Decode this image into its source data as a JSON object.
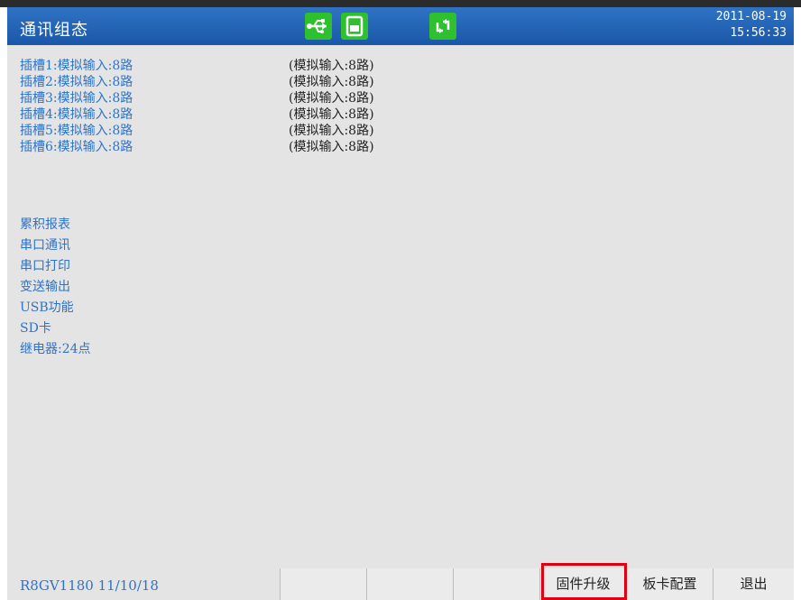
{
  "header": {
    "title": "通讯组态",
    "icons": [
      "usb-icon",
      "sd-card-icon",
      "sync-icon"
    ],
    "date": "2011-08-19",
    "time": "15:56:33",
    "colors": {
      "bar": "#1f5fb0",
      "usb": "#2ec02e",
      "sync": "#2ec02e"
    }
  },
  "slots": [
    {
      "label": "插槽1:模拟输入:8路",
      "detail": "(模拟输入:8路)"
    },
    {
      "label": "插槽2:模拟输入:8路",
      "detail": "(模拟输入:8路)"
    },
    {
      "label": "插槽3:模拟输入:8路",
      "detail": "(模拟输入:8路)"
    },
    {
      "label": "插槽4:模拟输入:8路",
      "detail": "(模拟输入:8路)"
    },
    {
      "label": "插槽5:模拟输入:8路",
      "detail": "(模拟输入:8路)"
    },
    {
      "label": "插槽6:模拟输入:8路",
      "detail": "(模拟输入:8路)"
    }
  ],
  "features": [
    "累积报表",
    "串口通讯",
    "串口打印",
    "变送输出",
    "USB功能",
    "SD卡",
    "继电器:24点"
  ],
  "footer": {
    "version": "R8GV1180 11/10/18",
    "softkeys": [
      "",
      "",
      "",
      "固件升级",
      "板卡配置",
      "退出"
    ],
    "highlighted": "固件升级"
  }
}
